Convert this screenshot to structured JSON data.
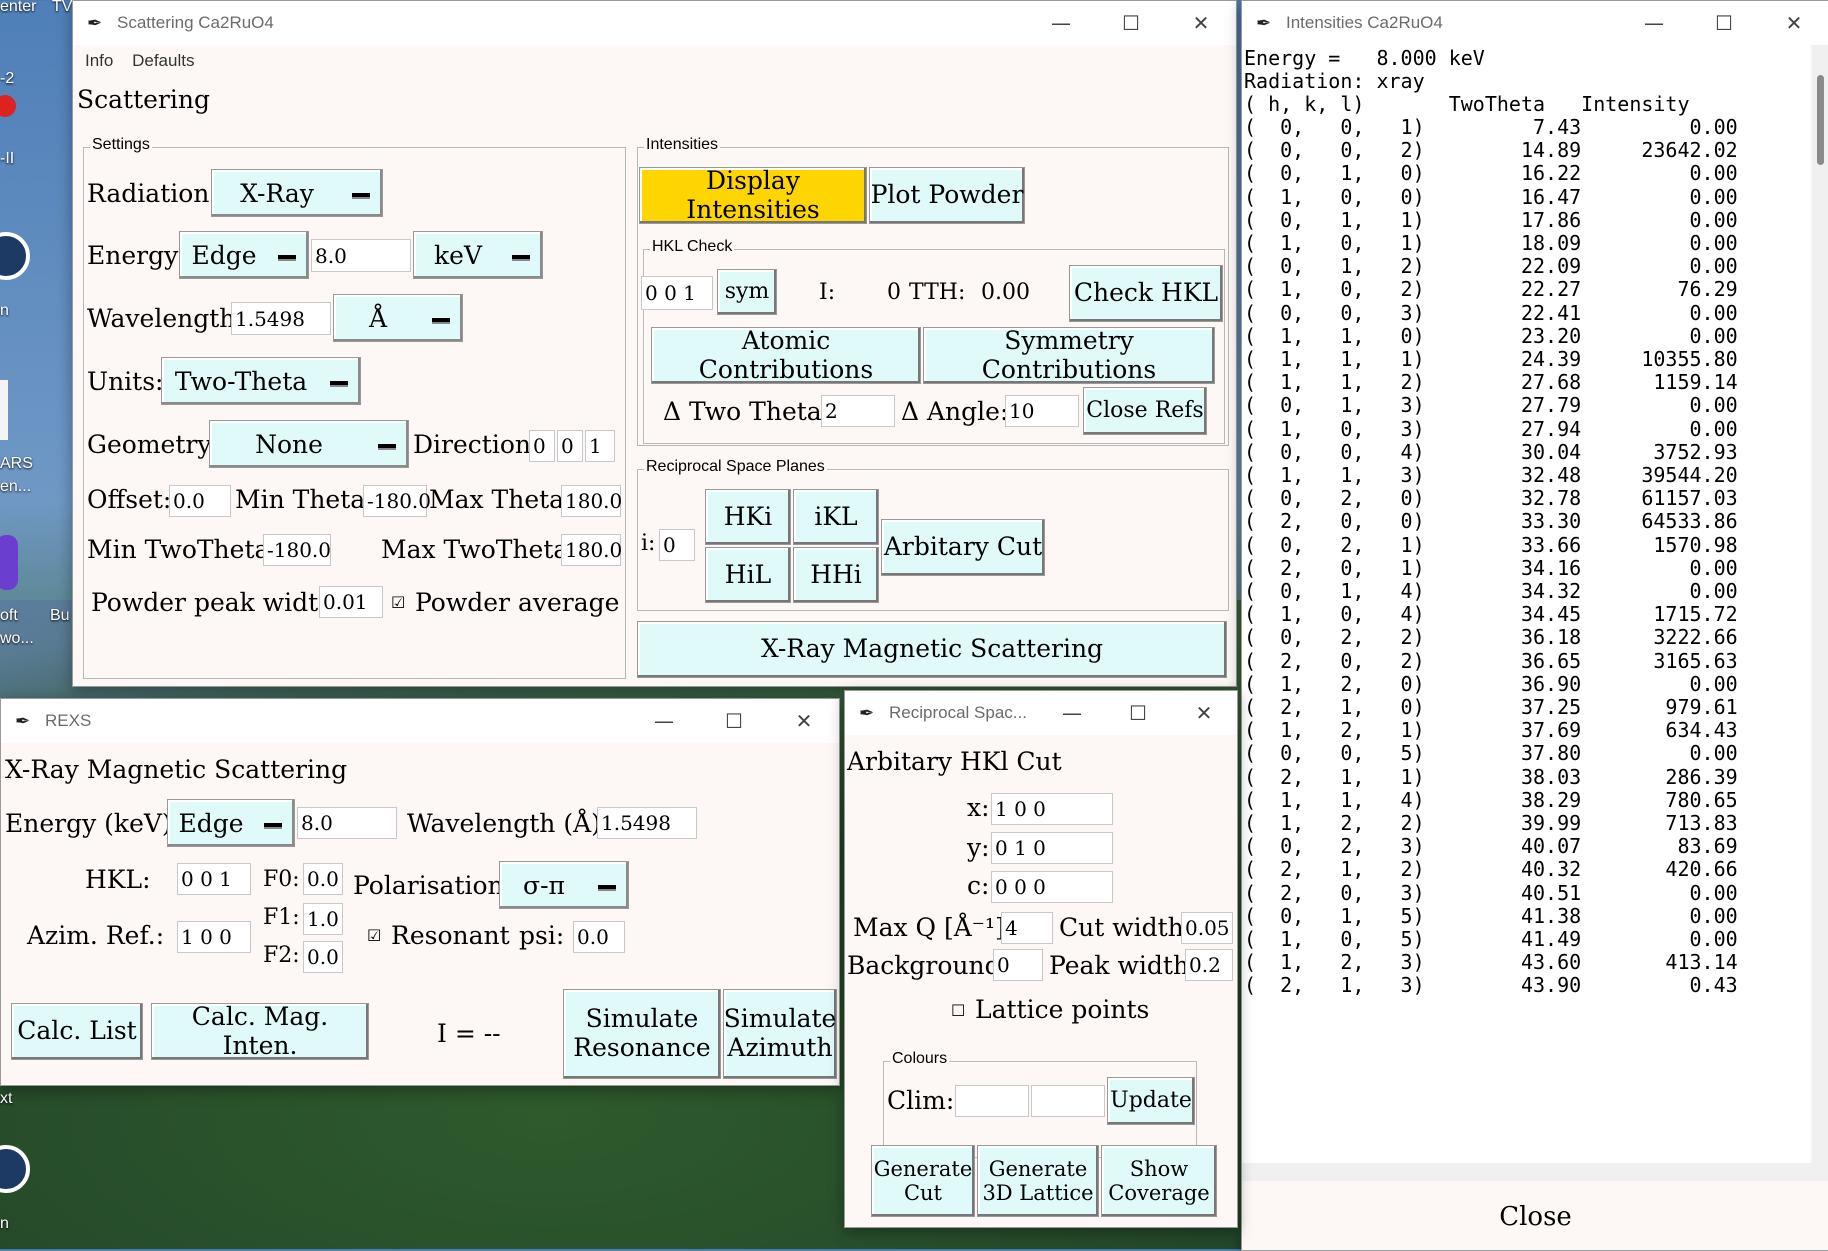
{
  "desktop": {
    "labels": [
      "enter",
      "TV",
      "-2",
      "-II",
      "n",
      "ARS",
      "en...",
      "oft",
      "wo...",
      "Bu",
      "xt",
      "n"
    ]
  },
  "scattering": {
    "title": "Scattering Ca2RuO4",
    "menu": [
      "Info",
      "Defaults"
    ],
    "heading": "Scattering",
    "settings": {
      "frame_title": "Settings",
      "radiation_label": "Radiation:",
      "radiation_value": "X-Ray",
      "energy_label": "Energy:",
      "energy_mode": "Edge",
      "energy_value": "8.0",
      "energy_unit": "keV",
      "wavelength_label": "Wavelength:",
      "wavelength_value": "1.5498",
      "wavelength_unit": "Å",
      "units_label": "Units:",
      "units_value": "Two-Theta",
      "geometry_label": "Geometry:",
      "geometry_value": "None",
      "direction_label": "Direction:",
      "direction_values": [
        "0",
        "0",
        "1"
      ],
      "offset_label": "Offset:",
      "offset_value": "0.0",
      "min_theta_label": "Min Theta:",
      "min_theta_value": "-180.0",
      "max_theta_label": "Max Theta:",
      "max_theta_value": "180.0",
      "min_twotheta_label": "Min TwoTheta:",
      "min_twotheta_value": "-180.0",
      "max_twotheta_label": "Max TwoTheta:",
      "max_twotheta_value": "180.0",
      "powder_width_label": "Powder peak width:",
      "powder_width_value": "0.01",
      "powder_average_label": "Powder average"
    },
    "intensities": {
      "frame_title": "Intensities",
      "display_button": "Display Intensities",
      "plot_powder_button": "Plot Powder",
      "hkl_check_title": "HKL Check",
      "hkl_value": "0 0 1",
      "sym_button": "sym",
      "i_label": "I:",
      "i_value": "0",
      "tth_label": "TTH:",
      "tth_value": "0.00",
      "check_hkl_button": "Check HKL",
      "atomic_button": "Atomic Contributions",
      "symmetry_button": "Symmetry Contributions",
      "two_theta_label": "Δ Two Theta:",
      "two_theta_value": "2",
      "angle_label": "Δ Angle:",
      "angle_value": "10",
      "close_refs_button": "Close Refs"
    },
    "planes": {
      "frame_title": "Reciprocal Space Planes",
      "i_label": "i:",
      "i_value": "0",
      "hki": "HKi",
      "ikl": "iKL",
      "hil": "HiL",
      "hhi": "HHi",
      "arbitrary_cut": "Arbitary Cut"
    },
    "xray_mag_button": "X-Ray Magnetic Scattering"
  },
  "rexs": {
    "title": "REXS",
    "heading": "X-Ray Magnetic Scattering",
    "energy_label": "Energy (keV):",
    "energy_mode": "Edge",
    "energy_value": "8.0",
    "wavelength_label": "Wavelength (Å):",
    "wavelength_value": "1.5498",
    "hkl_label": "HKL:",
    "hkl_value": "0 0 1",
    "f0_label": "F0:",
    "f0_value": "0.0",
    "f1_label": "F1:",
    "f1_value": "1.0",
    "f2_label": "F2:",
    "f2_value": "0.0",
    "polarisation_label": "Polarisation:",
    "polarisation_value": "σ-π",
    "azim_label": "Azim. Ref.:",
    "azim_value": "1 0 0",
    "resonant_label": "Resonant",
    "psi_label": "psi:",
    "psi_value": "0.0",
    "calc_list": "Calc. List",
    "calc_mag": "Calc. Mag. Inten.",
    "i_result": "I = --",
    "simulate_resonance": [
      "Simulate",
      "Resonance"
    ],
    "simulate_azimuth": [
      "Simulate",
      "Azimuth"
    ]
  },
  "recip": {
    "title": "Reciprocal Spac...",
    "heading": "Arbitary HKl Cut",
    "x_label": "x:",
    "x_value": "1 0 0",
    "y_label": "y:",
    "y_value": "0 1 0",
    "c_label": "c:",
    "c_value": "0 0 0",
    "maxq_label": "Max Q [Å⁻¹]:",
    "maxq_value": "4",
    "cutwidth_label": "Cut width:",
    "cutwidth_value": "0.05",
    "background_label": "Background:",
    "background_value": "0",
    "peakwidth_label": "Peak width:",
    "peakwidth_value": "0.2",
    "lattice_label": "Lattice points",
    "colours_title": "Colours",
    "clim_label": "Clim:",
    "update_button": "Update",
    "generate_cut": [
      "Generate",
      "Cut"
    ],
    "generate_3d": [
      "Generate",
      "3D Lattice"
    ],
    "show_coverage": [
      "Show",
      "Coverage"
    ]
  },
  "intensities_window": {
    "title": "Intensities Ca2RuO4",
    "header_lines": [
      "Energy =   8.000 keV",
      "Radiation: xray",
      "( h, k, l)       TwoTheta   Intensity"
    ],
    "rows": [
      [
        "0",
        "0",
        "1",
        "7.43",
        "0.00"
      ],
      [
        "0",
        "0",
        "2",
        "14.89",
        "23642.02"
      ],
      [
        "0",
        "1",
        "0",
        "16.22",
        "0.00"
      ],
      [
        "1",
        "0",
        "0",
        "16.47",
        "0.00"
      ],
      [
        "0",
        "1",
        "1",
        "17.86",
        "0.00"
      ],
      [
        "1",
        "0",
        "1",
        "18.09",
        "0.00"
      ],
      [
        "0",
        "1",
        "2",
        "22.09",
        "0.00"
      ],
      [
        "1",
        "0",
        "2",
        "22.27",
        "76.29"
      ],
      [
        "0",
        "0",
        "3",
        "22.41",
        "0.00"
      ],
      [
        "1",
        "1",
        "0",
        "23.20",
        "0.00"
      ],
      [
        "1",
        "1",
        "1",
        "24.39",
        "10355.80"
      ],
      [
        "1",
        "1",
        "2",
        "27.68",
        "1159.14"
      ],
      [
        "0",
        "1",
        "3",
        "27.79",
        "0.00"
      ],
      [
        "1",
        "0",
        "3",
        "27.94",
        "0.00"
      ],
      [
        "0",
        "0",
        "4",
        "30.04",
        "3752.93"
      ],
      [
        "1",
        "1",
        "3",
        "32.48",
        "39544.20"
      ],
      [
        "0",
        "2",
        "0",
        "32.78",
        "61157.03"
      ],
      [
        "2",
        "0",
        "0",
        "33.30",
        "64533.86"
      ],
      [
        "0",
        "2",
        "1",
        "33.66",
        "1570.98"
      ],
      [
        "2",
        "0",
        "1",
        "34.16",
        "0.00"
      ],
      [
        "0",
        "1",
        "4",
        "34.32",
        "0.00"
      ],
      [
        "1",
        "0",
        "4",
        "34.45",
        "1715.72"
      ],
      [
        "0",
        "2",
        "2",
        "36.18",
        "3222.66"
      ],
      [
        "2",
        "0",
        "2",
        "36.65",
        "3165.63"
      ],
      [
        "1",
        "2",
        "0",
        "36.90",
        "0.00"
      ],
      [
        "2",
        "1",
        "0",
        "37.25",
        "979.61"
      ],
      [
        "1",
        "2",
        "1",
        "37.69",
        "634.43"
      ],
      [
        "0",
        "0",
        "5",
        "37.80",
        "0.00"
      ],
      [
        "2",
        "1",
        "1",
        "38.03",
        "286.39"
      ],
      [
        "1",
        "1",
        "4",
        "38.29",
        "780.65"
      ],
      [
        "1",
        "2",
        "2",
        "39.99",
        "713.83"
      ],
      [
        "0",
        "2",
        "3",
        "40.07",
        "83.69"
      ],
      [
        "2",
        "1",
        "2",
        "40.32",
        "420.66"
      ],
      [
        "2",
        "0",
        "3",
        "40.51",
        "0.00"
      ],
      [
        "0",
        "1",
        "5",
        "41.38",
        "0.00"
      ],
      [
        "1",
        "0",
        "5",
        "41.49",
        "0.00"
      ],
      [
        "1",
        "2",
        "3",
        "43.60",
        "413.14"
      ],
      [
        "2",
        "1",
        "3",
        "43.90",
        "0.43"
      ]
    ],
    "close_button": "Close"
  }
}
